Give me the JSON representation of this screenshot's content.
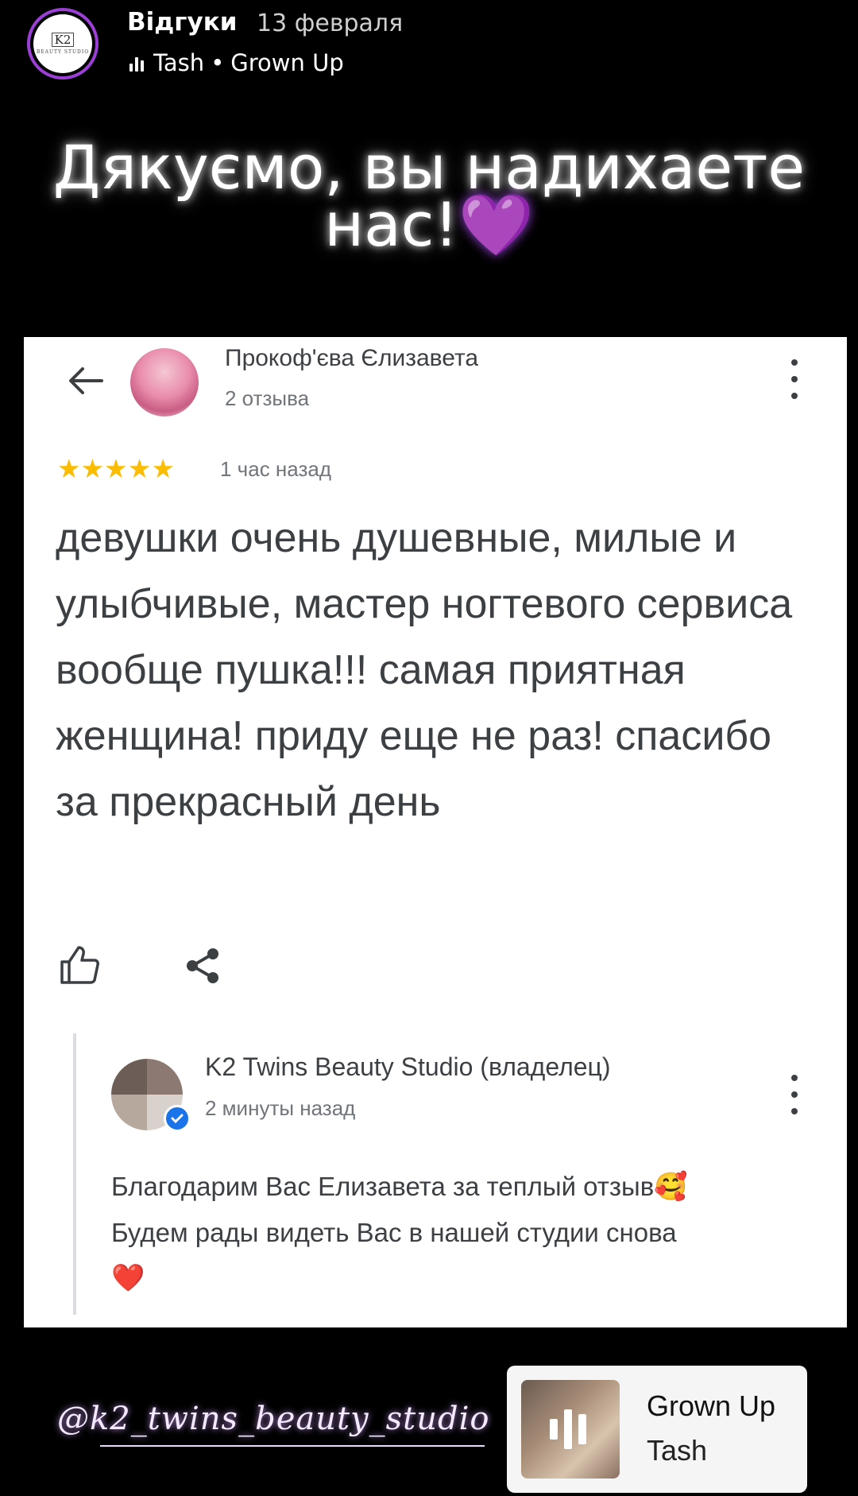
{
  "story": {
    "title": "Відгуки",
    "date": "13 февраля",
    "music_artist": "Tash",
    "music_separator": "•",
    "music_song": "Grown Up",
    "avatar_logo": "K2",
    "avatar_sub": "BEAUTY STUDIO",
    "caption": "Дякуємо, вы надихаете нас!",
    "caption_emoji": "💜"
  },
  "review": {
    "reviewer_name": "Прокоф'єва Єлизавета",
    "reviewer_count": "2 отзыва",
    "stars": "★★★★★",
    "rating": 5,
    "time": "1 час назад",
    "text": "девушки очень душевные, милые и улыбчивые, мастер ногтевого сервиса вообще пушка!!! самая приятная женщина! приду еще не раз! спасибо за прекрасный день",
    "icons": [
      "back-arrow-icon",
      "more-vert-icon",
      "thumbs-up-icon",
      "share-icon"
    ]
  },
  "owner_reply": {
    "name": "K2 Twins Beauty Studio (владелец)",
    "time": "2 минуты назад",
    "text_line1": "Благодарим Вас Елизавета за теплый отзыв",
    "emoji1": "🥰",
    "text_line2": "Будем рады видеть Вас в нашей студии снова",
    "emoji2": "❤️",
    "badge_color": "#1a73e8"
  },
  "footer": {
    "handle": "@k2_twins_beauty_studio",
    "music_title": "Grown Up",
    "music_artist": "Tash"
  },
  "colors": {
    "accent_purple": "#9b3fd6",
    "star_yellow": "#fbbc04",
    "heart_red": "#e0245e"
  }
}
